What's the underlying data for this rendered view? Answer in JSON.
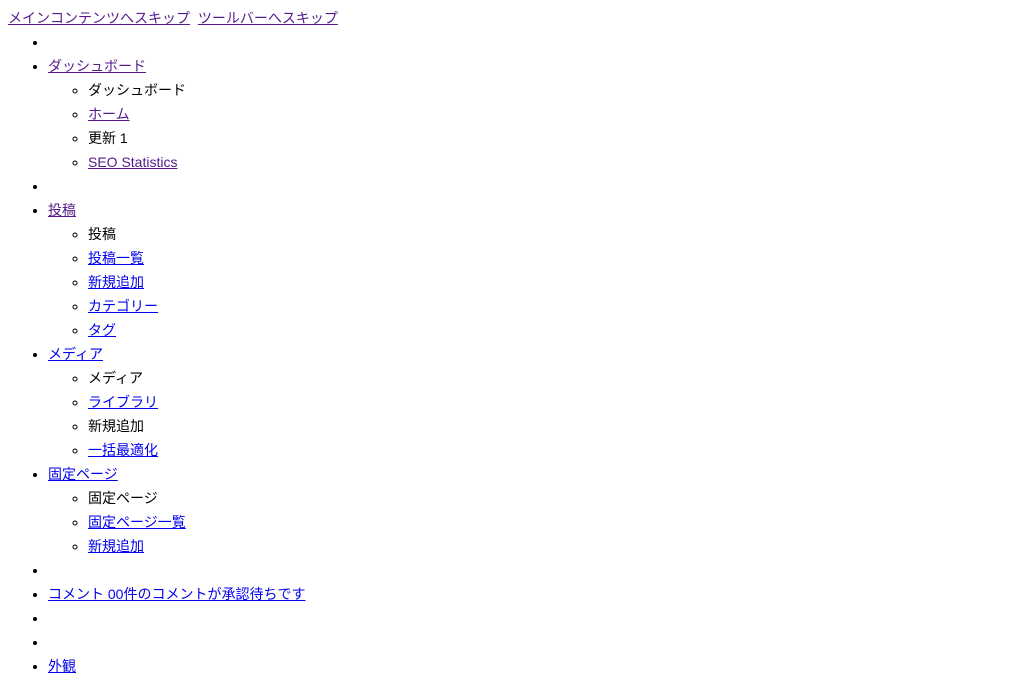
{
  "skipLinks": {
    "mainContent": "メインコンテンツへスキップ",
    "toolbar": "ツールバーへスキップ"
  },
  "menu": {
    "dashboard": {
      "label": "ダッシュボード",
      "items": {
        "dashboard": "ダッシュボード",
        "home": "ホーム",
        "updates": "更新 1",
        "seoStats": "SEO Statistics"
      }
    },
    "posts": {
      "label": "投稿",
      "items": {
        "posts": "投稿",
        "allPosts": "投稿一覧",
        "addNew": "新規追加",
        "categories": "カテゴリー",
        "tags": "タグ"
      }
    },
    "media": {
      "label": "メディア",
      "items": {
        "media": "メディア",
        "library": "ライブラリ",
        "addNew": "新規追加",
        "bulkOptimize": "一括最適化"
      }
    },
    "pages": {
      "label": "固定ページ",
      "items": {
        "pages": "固定ページ",
        "allPages": "固定ページ一覧",
        "addNew": "新規追加"
      }
    },
    "comments": {
      "label": "コメント 00件のコメントが承認待ちです"
    },
    "appearance": {
      "label": "外観"
    }
  }
}
